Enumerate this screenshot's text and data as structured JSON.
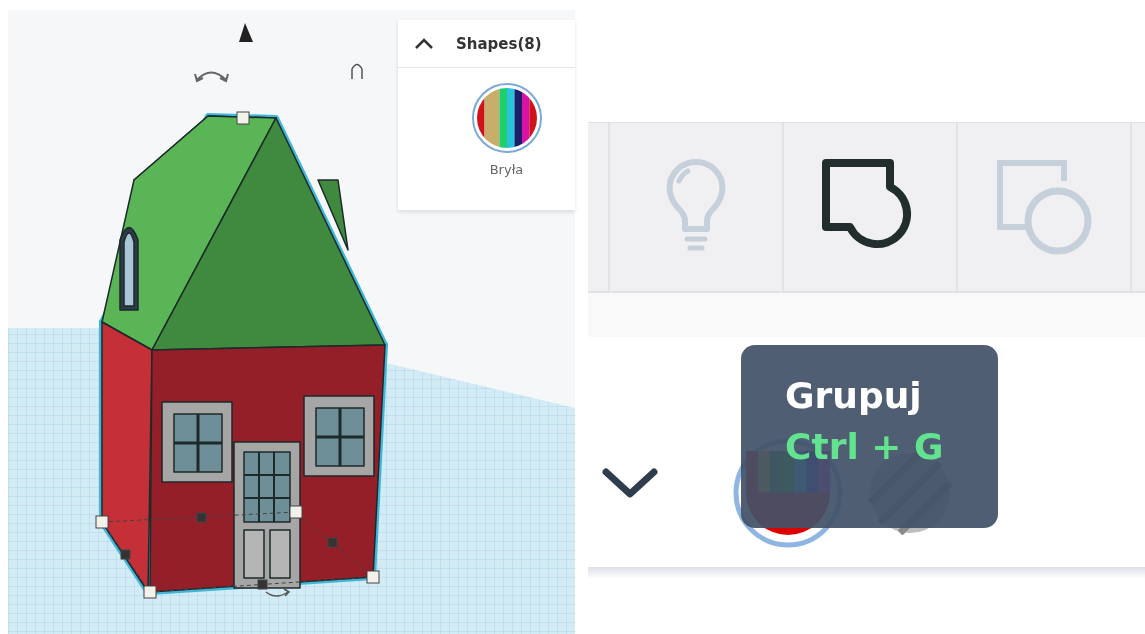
{
  "viewport": {
    "shapes_panel": {
      "title": "Shapes(8)",
      "expanded": true,
      "items": [
        {
          "label": "Bryła"
        }
      ]
    }
  },
  "toolbar": {
    "buttons": [
      {
        "kind": "light",
        "disabled": true
      },
      {
        "kind": "group",
        "disabled": false
      },
      {
        "kind": "ungroup",
        "disabled": true
      }
    ]
  },
  "tooltip": {
    "title": "Grupuj",
    "shortcut": "Ctrl + G"
  },
  "shapes_panel_2": {
    "expanded": false
  }
}
